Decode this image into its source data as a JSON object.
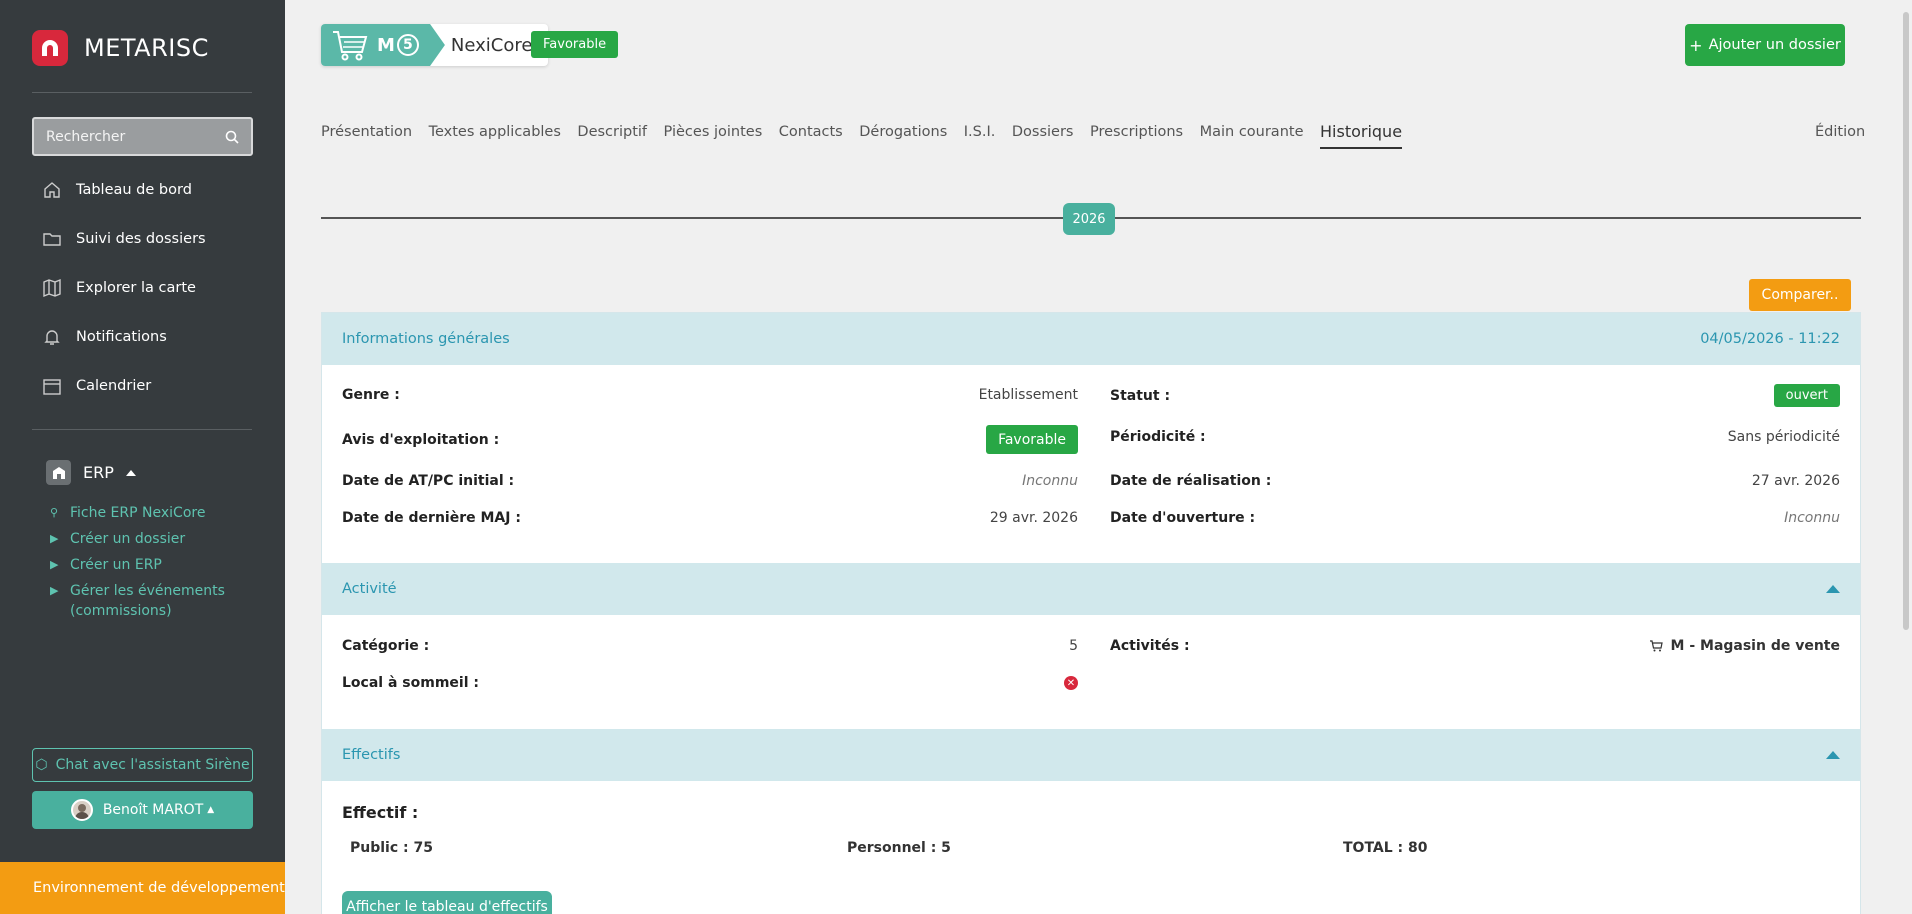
{
  "app": {
    "title": "METARISC"
  },
  "search": {
    "placeholder": "Rechercher"
  },
  "nav": [
    {
      "label": "Tableau de bord",
      "icon": "home-icon"
    },
    {
      "label": "Suivi des dossiers",
      "icon": "folder-icon"
    },
    {
      "label": "Explorer la carte",
      "icon": "map-icon"
    },
    {
      "label": "Notifications",
      "icon": "bell-icon"
    },
    {
      "label": "Calendrier",
      "icon": "calendar-icon"
    }
  ],
  "erp_menu": {
    "title": "ERP",
    "items": [
      {
        "label": "Fiche ERP NexiCore",
        "icon": "pin-icon"
      },
      {
        "label": "Créer un dossier",
        "icon": "caret-right-icon"
      },
      {
        "label": "Créer un ERP",
        "icon": "caret-right-icon"
      },
      {
        "label": "Gérer les événements",
        "label2": "(commissions)",
        "icon": "caret-right-icon"
      }
    ]
  },
  "chat": {
    "label": "Chat avec l'assistant Sirène"
  },
  "user": {
    "name": "Benoît MAROT"
  },
  "env": {
    "label": "Environnement de développement"
  },
  "header": {
    "type_code": "M",
    "category": "5",
    "name": "NexiCore",
    "avis": "Favorable",
    "add_button": "Ajouter un dossier"
  },
  "tabs": [
    "Présentation",
    "Textes applicables",
    "Descriptif",
    "Pièces jointes",
    "Contacts",
    "Dérogations",
    "I.S.I.",
    "Dossiers",
    "Prescriptions",
    "Main courante",
    "Historique"
  ],
  "active_tab": "Historique",
  "edition": "Édition",
  "timeline": {
    "year": "2026"
  },
  "compare": "Comparer..",
  "general": {
    "title": "Informations générales",
    "date": "04/05/2026 - 11:22",
    "genre_label": "Genre :",
    "genre": "Etablissement",
    "statut_label": "Statut :",
    "statut": "ouvert",
    "avis_label": "Avis d'exploitation :",
    "avis": "Favorable",
    "periodicite_label": "Périodicité :",
    "periodicite": "Sans périodicité",
    "date_at_label": "Date de AT/PC initial :",
    "date_at": "Inconnu",
    "date_real_label": "Date de réalisation :",
    "date_real": "27 avr. 2026",
    "date_maj_label": "Date de dernière MAJ :",
    "date_maj": "29 avr. 2026",
    "date_ouv_label": "Date d'ouverture :",
    "date_ouv": "Inconnu"
  },
  "activite": {
    "title": "Activité",
    "categorie_label": "Catégorie :",
    "categorie": "5",
    "activites_label": "Activités :",
    "activites": "M - Magasin de vente",
    "sommeil_label": "Local à sommeil :"
  },
  "effectifs": {
    "title": "Effectifs",
    "heading": "Effectif :",
    "public": "Public : 75",
    "personnel": "Personnel : 5",
    "total": "TOTAL : 80",
    "button": "Afficher le tableau d'effectifs"
  }
}
